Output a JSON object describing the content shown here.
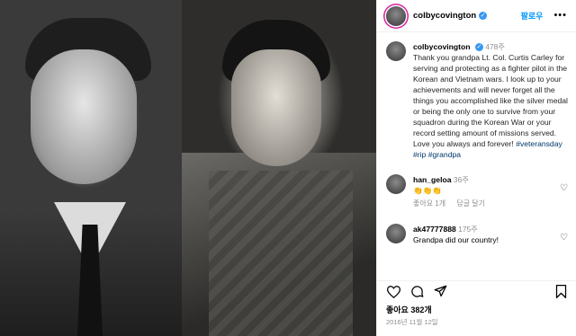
{
  "post": {
    "username": "colbycovington",
    "follow_label": "팔로우",
    "more_label": "•••"
  },
  "caption": {
    "username": "colbycovington",
    "time": "478주",
    "text": "Thank you grandpa Lt. Col. Curtis Carley for serving and protecting as a fighter pilot in the Korean and Vietnam wars. I look up to your achievements and will never forget all the things you accomplished like the silver medal or being the only one to survive from your squadron during the Korean War or your record setting amount of missions served. Love you always and forever!",
    "hashtags": [
      "#veteransday",
      "#rip",
      "#grandpa"
    ]
  },
  "comments": [
    {
      "username": "han_geloa",
      "time": "36주",
      "text": "👏👏👏",
      "likes": "좋아요 1개",
      "reply_label": "답글 달기"
    },
    {
      "username": "ak47777888",
      "time": "175주",
      "text": "Grandpa did our country!"
    }
  ],
  "actions": {
    "icons": [
      "heart-icon",
      "comment-icon",
      "share-icon",
      "bookmark-icon"
    ]
  },
  "likes_text": "좋아요 382개",
  "date_text": "2016년 11월 12일",
  "colors": {
    "accent": "#0095f6",
    "verified": "#3897f0",
    "hashtag": "#00376b",
    "muted": "#8e8e8e"
  }
}
